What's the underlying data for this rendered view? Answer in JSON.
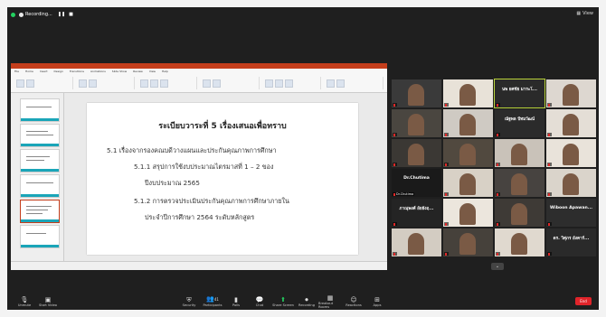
{
  "window": {
    "recording_label": "Recording...",
    "view_label": "View"
  },
  "ppt": {
    "title_bar": "",
    "tabs": [
      "File",
      "Home",
      "Insert",
      "Design",
      "Transitions",
      "Animations",
      "Slide Show",
      "Review",
      "View",
      "Help"
    ],
    "status_text": ""
  },
  "slide": {
    "title": "ระเบียบวาระที่ 5 เรื่องเสนอเพื่อทราบ",
    "lines": [
      "5.1 เรื่องจากรองคณบดีวางแผนและประกันคุณภาพการศึกษา",
      "5.1.1 สรุปการใช้งบประมาณไตรมาสที่ 1 – 2 ของ",
      "ปีงบประมาณ 2565",
      "5.1.2 การตรวจประเมินประกันคุณภาพการศึกษาภายใน",
      "ประจำปีการศึกษา 2564 ระดับหลักสูตร"
    ]
  },
  "gallery": {
    "tiles": [
      {
        "name": "",
        "label": ""
      },
      {
        "name": "",
        "label": ""
      },
      {
        "name": "นพ ยศชัย มาระโ...",
        "label": ""
      },
      {
        "name": "",
        "label": ""
      },
      {
        "name": "",
        "label": ""
      },
      {
        "name": "",
        "label": ""
      },
      {
        "name": "ณัฐพล ปัทมวัฒน์",
        "label": ""
      },
      {
        "name": "",
        "label": ""
      },
      {
        "name": "",
        "label": ""
      },
      {
        "name": "",
        "label": ""
      },
      {
        "name": "",
        "label": ""
      },
      {
        "name": "",
        "label": ""
      },
      {
        "name": "Dr.Chutima",
        "label": "Dr.Chutima"
      },
      {
        "name": "",
        "label": ""
      },
      {
        "name": "",
        "label": ""
      },
      {
        "name": "",
        "label": ""
      },
      {
        "name": "ภาณุพงศ์ อัยยังฤ...",
        "label": ""
      },
      {
        "name": "",
        "label": ""
      },
      {
        "name": "",
        "label": ""
      },
      {
        "name": "Wiboon Apawan...",
        "label": ""
      },
      {
        "name": "",
        "label": ""
      },
      {
        "name": "",
        "label": ""
      },
      {
        "name": "",
        "label": ""
      },
      {
        "name": "ดร. วิศุภร อังคาร์...",
        "label": ""
      }
    ],
    "more_label": "⌄"
  },
  "toolbar": {
    "unmute": "Unmute",
    "start_video": "Start Video",
    "security": "Security",
    "participants": "Participants",
    "participants_count": "41",
    "polls": "Polls",
    "chat": "Chat",
    "share_screen": "Share Screen",
    "recording": "Recording",
    "breakout": "Breakout Rooms",
    "reactions": "Reactions",
    "apps": "Apps",
    "end": "End"
  },
  "colors": {
    "accent_green": "#23d160",
    "end_red": "#e0242a",
    "ppt_red": "#c43e1c"
  }
}
